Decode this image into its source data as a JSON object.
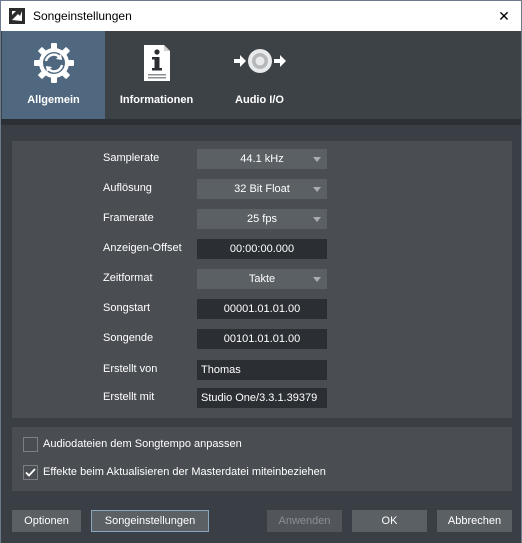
{
  "window": {
    "title": "Songeinstellungen"
  },
  "tabs": [
    {
      "label": "Allgemein",
      "icon": "gear-refresh-icon",
      "active": true
    },
    {
      "label": "Informationen",
      "icon": "info-document-icon",
      "active": false
    },
    {
      "label": "Audio I/O",
      "icon": "audio-io-icon",
      "active": false
    }
  ],
  "settings": {
    "samplerate": {
      "label": "Samplerate",
      "value": "44.1 kHz"
    },
    "aufloesung": {
      "label": "Auflösung",
      "value": "32 Bit Float"
    },
    "framerate": {
      "label": "Framerate",
      "value": "25 fps"
    },
    "anzeigen_offset": {
      "label": "Anzeigen-Offset",
      "value": "00:00:00.000"
    },
    "zeitformat": {
      "label": "Zeitformat",
      "value": "Takte"
    },
    "songstart": {
      "label": "Songstart",
      "value": "00001.01.01.00"
    },
    "songende": {
      "label": "Songende",
      "value": "00101.01.01.00"
    },
    "erstellt_von": {
      "label": "Erstellt von",
      "value": "Thomas"
    },
    "erstellt_mit": {
      "label": "Erstellt mit",
      "value": "Studio One/3.3.1.39379"
    }
  },
  "options": {
    "audiodateien": {
      "label": "Audiodateien dem Songtempo anpassen",
      "checked": false
    },
    "effekte": {
      "label": "Effekte beim Aktualisieren der Masterdatei miteinbeziehen",
      "checked": true
    }
  },
  "buttons": {
    "optionen": "Optionen",
    "songeinstellungen": "Songeinstellungen",
    "anwenden": "Anwenden",
    "ok": "OK",
    "abbrechen": "Abbrechen"
  },
  "colors": {
    "active_tab": "#4f687f",
    "panel": "#4a4e53",
    "background": "#3a3f45"
  }
}
